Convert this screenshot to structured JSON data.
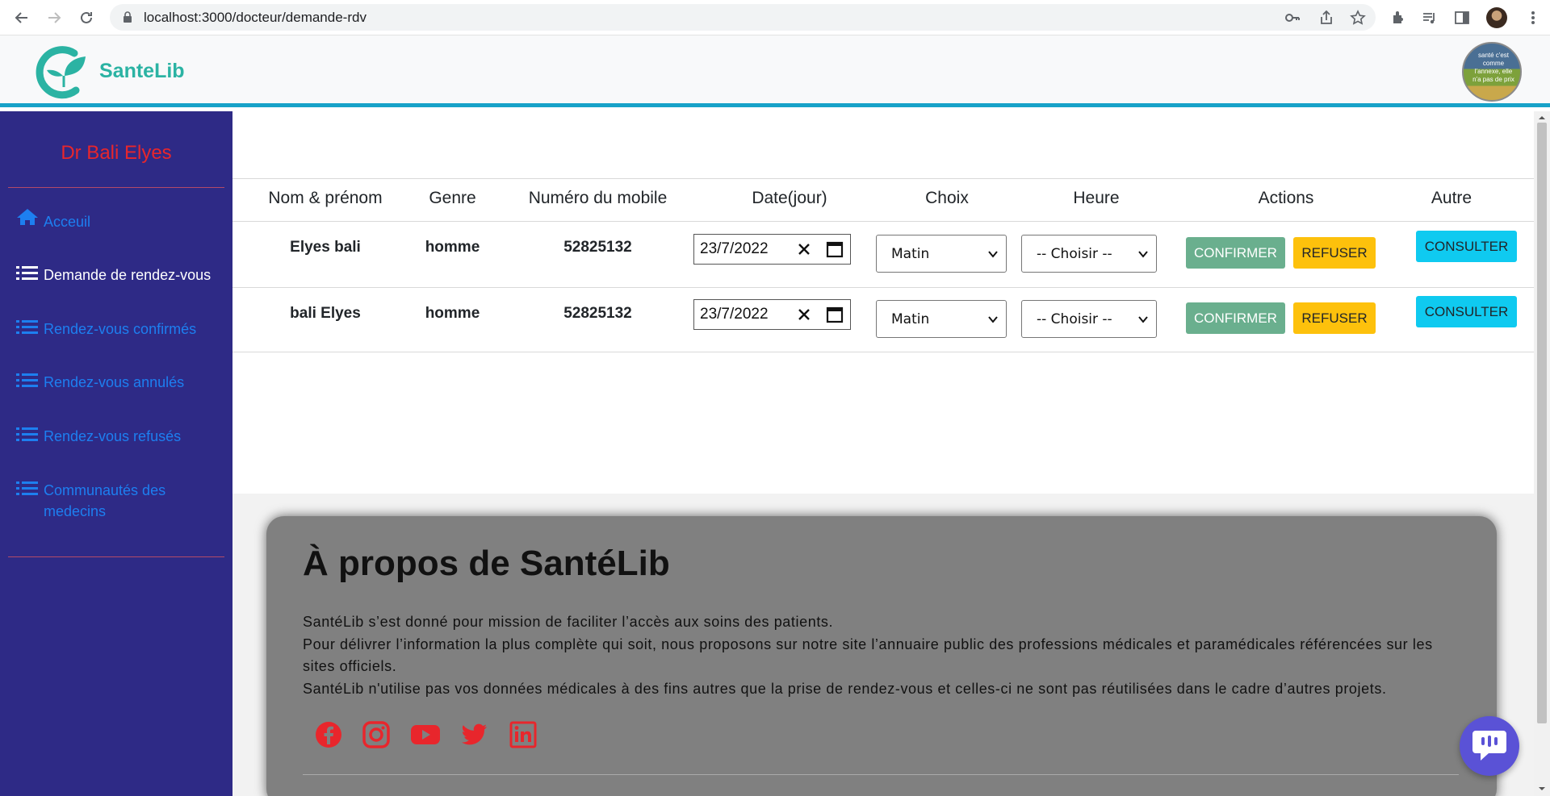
{
  "browser": {
    "url": "localhost:3000/docteur/demande-rdv"
  },
  "app": {
    "logo_text": "SanteLib",
    "avatar_caption": "santé c'est comme l'annexe, elle n'a pas de prix"
  },
  "sidebar": {
    "doctor_name": "Dr Bali Elyes",
    "items": [
      {
        "label": "Acceuil",
        "icon": "home-icon",
        "active": false
      },
      {
        "label": "Demande de rendez-vous",
        "icon": "list-icon",
        "active": true
      },
      {
        "label": "Rendez-vous confirmés",
        "icon": "list-icon",
        "active": false
      },
      {
        "label": "Rendez-vous annulés",
        "icon": "list-icon",
        "active": false
      },
      {
        "label": "Rendez-vous refusés",
        "icon": "list-icon",
        "active": false
      },
      {
        "label": "Communautés des medecins",
        "icon": "list-icon",
        "active": false
      }
    ]
  },
  "table": {
    "headers": [
      "Nom & prénom",
      "Genre",
      "Numéro du mobile",
      "Date(jour)",
      "Choix",
      "Heure",
      "Actions",
      "Autre"
    ],
    "rows": [
      {
        "name": "Elyes bali",
        "genre": "homme",
        "mobile": "52825132",
        "date": "23/7/2022",
        "choix": "Matin",
        "heure": "-- Choisir --"
      },
      {
        "name": "bali Elyes",
        "genre": "homme",
        "mobile": "52825132",
        "date": "23/7/2022",
        "choix": "Matin",
        "heure": "-- Choisir --"
      }
    ],
    "confirm_label": "CONFIRMER",
    "refuse_label": "REFUSER",
    "consult_label": "CONSULTER"
  },
  "footer": {
    "title": "À propos de SantéLib",
    "paragraphs": [
      "SantéLib s’est donné pour mission de faciliter l’accès aux soins des patients.",
      "Pour délivrer l’information la plus complète qui soit, nous proposons sur notre site l’annuaire public des professions médicales et paramédicales référencées sur les sites officiels.",
      "SantéLib n'utilise pas vos données médicales à des fins autres que la prise de rendez-vous et celles-ci ne sont pas réutilisées dans le cadre d’autres projets."
    ],
    "social": [
      "facebook-icon",
      "instagram-icon",
      "youtube-icon",
      "twitter-icon",
      "linkedin-icon"
    ]
  },
  "colors": {
    "sidebar_bg": "#2e2a86",
    "doctor_name": "#e8262c",
    "link": "#1d7ff0",
    "accent_bar": "#17a2c8",
    "confirm": "#6aaf8e",
    "refuse": "#fdc10c",
    "consult": "#0fcaf0",
    "social": "#e8262c"
  }
}
